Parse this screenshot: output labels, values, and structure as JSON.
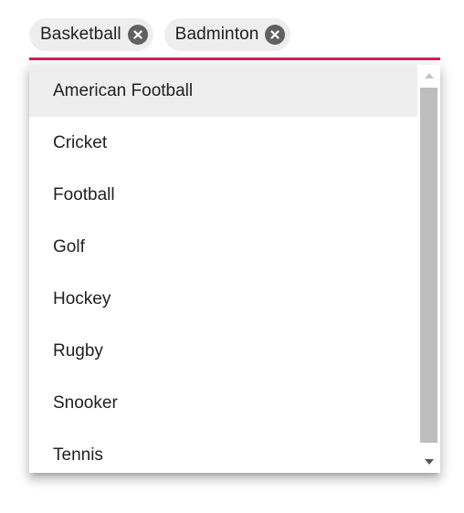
{
  "multiselect": {
    "chips": [
      {
        "label": "Basketball",
        "remove_icon": "close-circle-icon"
      },
      {
        "label": "Badminton",
        "remove_icon": "close-circle-icon"
      }
    ],
    "accent_color": "#d81b60"
  },
  "dropdown": {
    "items": [
      {
        "label": "American Football",
        "active": true
      },
      {
        "label": "Cricket"
      },
      {
        "label": "Football"
      },
      {
        "label": "Golf"
      },
      {
        "label": "Hockey"
      },
      {
        "label": "Rugby"
      },
      {
        "label": "Snooker"
      },
      {
        "label": "Tennis"
      }
    ],
    "scrollbar": {
      "up_icon": "arrow-up-icon",
      "down_icon": "arrow-down-icon"
    }
  }
}
